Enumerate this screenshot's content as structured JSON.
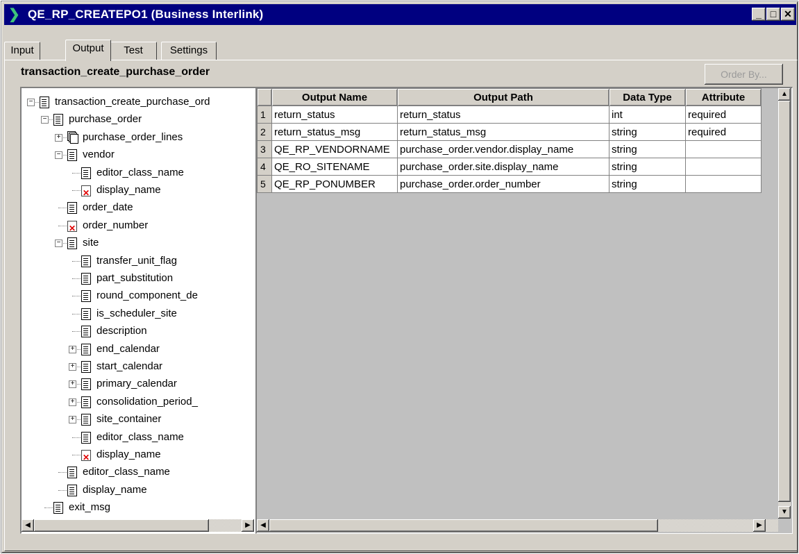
{
  "window": {
    "title": "QE_RP_CREATEPO1 (Business Interlink)",
    "icon": "interlink-arrow-icon",
    "controls": {
      "minimize": "_",
      "maximize": "□",
      "close": "✕"
    }
  },
  "tabs": [
    {
      "label": "Input",
      "active": false
    },
    {
      "label": "Output",
      "active": true
    },
    {
      "label": "Test",
      "active": false
    },
    {
      "label": "Settings",
      "active": false
    }
  ],
  "panel": {
    "title": "transaction_create_purchase_order",
    "order_by_label": "Order By...",
    "order_by_enabled": false
  },
  "tree": {
    "nodes": [
      {
        "label": "transaction_create_purchase_ord",
        "depth": 0,
        "expander": "-",
        "icon": "document-icon"
      },
      {
        "label": "purchase_order",
        "depth": 1,
        "expander": "-",
        "icon": "document-icon"
      },
      {
        "label": "purchase_order_lines",
        "depth": 2,
        "expander": "+",
        "icon": "multi-document-icon"
      },
      {
        "label": "vendor",
        "depth": 2,
        "expander": "-",
        "icon": "document-icon"
      },
      {
        "label": "editor_class_name",
        "depth": 3,
        "expander": "",
        "icon": "document-icon"
      },
      {
        "label": "display_name",
        "depth": 3,
        "expander": "",
        "icon": "required-field-icon"
      },
      {
        "label": "order_date",
        "depth": 2,
        "expander": "",
        "icon": "document-icon"
      },
      {
        "label": "order_number",
        "depth": 2,
        "expander": "",
        "icon": "required-field-icon"
      },
      {
        "label": "site",
        "depth": 2,
        "expander": "-",
        "icon": "document-icon"
      },
      {
        "label": "transfer_unit_flag",
        "depth": 3,
        "expander": "",
        "icon": "document-icon"
      },
      {
        "label": "part_substitution",
        "depth": 3,
        "expander": "",
        "icon": "document-icon"
      },
      {
        "label": "round_component_de",
        "depth": 3,
        "expander": "",
        "icon": "document-icon"
      },
      {
        "label": "is_scheduler_site",
        "depth": 3,
        "expander": "",
        "icon": "document-icon"
      },
      {
        "label": "description",
        "depth": 3,
        "expander": "",
        "icon": "document-icon"
      },
      {
        "label": "end_calendar",
        "depth": 3,
        "expander": "+",
        "icon": "document-icon"
      },
      {
        "label": "start_calendar",
        "depth": 3,
        "expander": "+",
        "icon": "document-icon"
      },
      {
        "label": "primary_calendar",
        "depth": 3,
        "expander": "+",
        "icon": "document-icon"
      },
      {
        "label": "consolidation_period_",
        "depth": 3,
        "expander": "+",
        "icon": "document-icon"
      },
      {
        "label": "site_container",
        "depth": 3,
        "expander": "+",
        "icon": "document-icon"
      },
      {
        "label": "editor_class_name",
        "depth": 3,
        "expander": "",
        "icon": "document-icon"
      },
      {
        "label": "display_name",
        "depth": 3,
        "expander": "",
        "icon": "required-field-icon"
      },
      {
        "label": "editor_class_name",
        "depth": 2,
        "expander": "",
        "icon": "document-icon"
      },
      {
        "label": "display_name",
        "depth": 2,
        "expander": "",
        "icon": "document-icon"
      },
      {
        "label": "exit_msg",
        "depth": 1,
        "expander": "",
        "icon": "document-icon"
      }
    ]
  },
  "grid": {
    "columns": [
      "Output Name",
      "Output Path",
      "Data Type",
      "Attribute"
    ],
    "rows": [
      {
        "num": "1",
        "name": "return_status",
        "path": "return_status",
        "type": "int",
        "attribute": "required"
      },
      {
        "num": "2",
        "name": "return_status_msg",
        "path": "return_status_msg",
        "type": "string",
        "attribute": "required"
      },
      {
        "num": "3",
        "name": "QE_RP_VENDORNAME",
        "path": "purchase_order.vendor.display_name",
        "type": "string",
        "attribute": ""
      },
      {
        "num": "4",
        "name": "QE_RO_SITENAME",
        "path": "purchase_order.site.display_name",
        "type": "string",
        "attribute": ""
      },
      {
        "num": "5",
        "name": "QE_RP_PONUMBER",
        "path": "purchase_order.order_number",
        "type": "string",
        "attribute": ""
      }
    ]
  },
  "scrollbars": {
    "left_arrow": "◀",
    "right_arrow": "▶",
    "up_arrow": "▲",
    "down_arrow": "▼"
  }
}
